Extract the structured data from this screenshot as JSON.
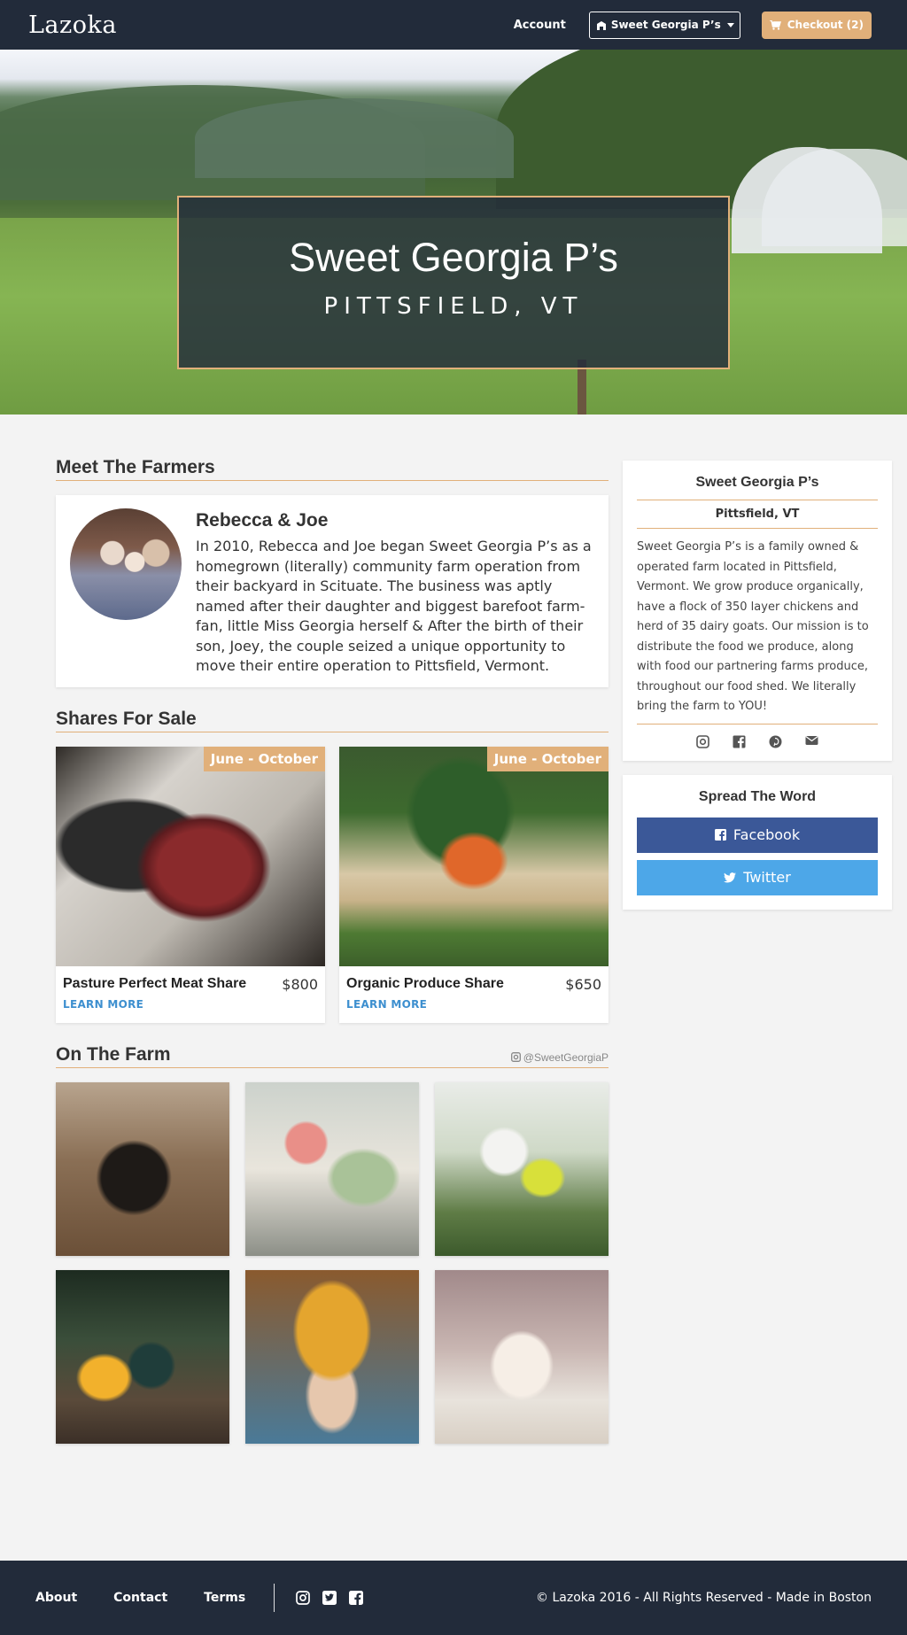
{
  "navbar": {
    "brand": "Lazoka",
    "account_label": "Account",
    "farm_selector_label": "Sweet Georgia P’s",
    "checkout_label": "Checkout (2)"
  },
  "hero": {
    "title": "Sweet Georgia P’s",
    "location": "PITTSFIELD, VT"
  },
  "farmers": {
    "heading": "Meet The Farmers",
    "name": "Rebecca & Joe",
    "bio": "In 2010, Rebecca and Joe began Sweet Georgia P’s as a homegrown (literally) community farm operation from their backyard in Scituate. The business was aptly named after their daughter and biggest barefoot farm-fan, little Miss Georgia herself & After the birth of their son, Joey, the couple seized a unique opportunity to move their entire operation to Pittsfield, Vermont."
  },
  "shares": {
    "heading": "Shares For Sale",
    "items": [
      {
        "name": "Pasture Perfect Meat Share",
        "price": "$800",
        "season": "June - October",
        "link": "LEARN MORE"
      },
      {
        "name": "Organic Produce Share",
        "price": "$650",
        "season": "June - October",
        "link": "LEARN MORE"
      }
    ]
  },
  "farm_gallery": {
    "heading": "On The Farm",
    "instagram_handle": "@SweetGeorgiaP"
  },
  "sidebar": {
    "farm_name": "Sweet Georgia P’s",
    "location": "Pittsfield, VT",
    "description": "Sweet Georgia P’s is a family owned & operated farm located in Pittsfield, Vermont. We grow produce organically, have a flock of 350 layer chickens and herd of 35 dairy goats. Our mission is to distribute the food we produce, along with food our partnering farms produce, throughout our food shed. We literally bring the farm to YOU!",
    "spread_title": "Spread The Word",
    "facebook_label": "Facebook",
    "twitter_label": "Twitter"
  },
  "footer": {
    "about": "About",
    "contact": "Contact",
    "terms": "Terms",
    "copyright": "© Lazoka 2016 - All Rights Reserved - Made in Boston"
  },
  "colors": {
    "navy": "#222b3a",
    "accent": "#e1b07a",
    "link": "#3d8fcf",
    "facebook": "#3b5898",
    "twitter": "#4da7e8"
  }
}
